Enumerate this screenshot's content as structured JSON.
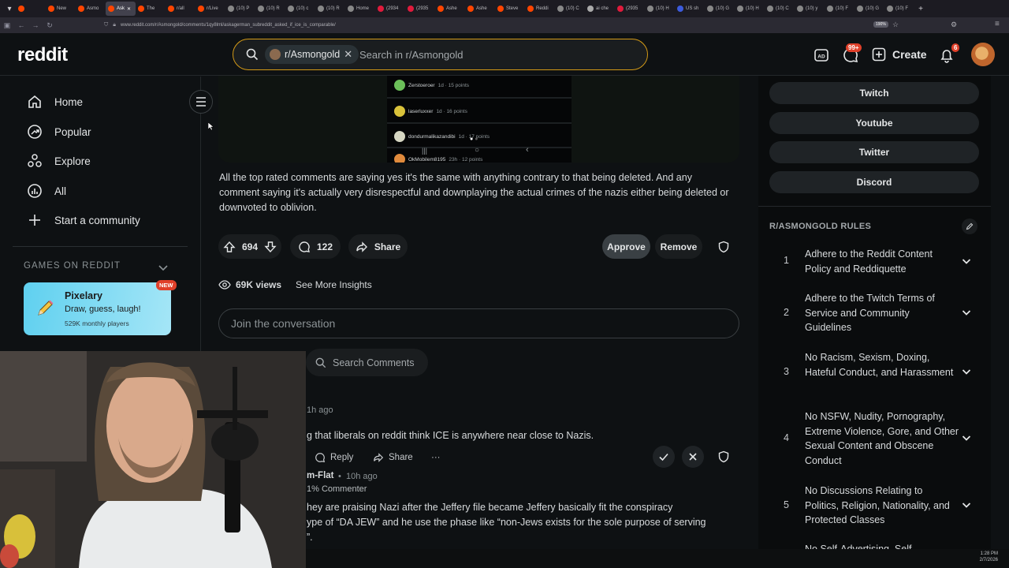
{
  "browser": {
    "tabs": [
      {
        "label": "",
        "color": "#ff4500"
      },
      {
        "label": "New",
        "color": "#ff4500"
      },
      {
        "label": "Asmo",
        "color": "#ff4500"
      },
      {
        "label": "Ask",
        "color": "#ff4500",
        "active": true
      },
      {
        "label": "The",
        "color": "#ff4500"
      },
      {
        "label": "r/all",
        "color": "#ff4500"
      },
      {
        "label": "r/Live",
        "color": "#ff4500"
      },
      {
        "label": "(10) P",
        "color": "#888888"
      },
      {
        "label": "(10) R",
        "color": "#888888"
      },
      {
        "label": "(10) c",
        "color": "#888888"
      },
      {
        "label": "(10) R",
        "color": "#888888"
      },
      {
        "label": "Home",
        "color": "#888888"
      },
      {
        "label": "(2934",
        "color": "#e01b3c"
      },
      {
        "label": "(2935",
        "color": "#e01b3c"
      },
      {
        "label": "Ashe",
        "color": "#ff4500"
      },
      {
        "label": "Ashe",
        "color": "#ff4500"
      },
      {
        "label": "Steve",
        "color": "#ff4500"
      },
      {
        "label": "Reddi",
        "color": "#ff4500"
      },
      {
        "label": "(10) C",
        "color": "#888888"
      },
      {
        "label": "ai che",
        "color": "#aaaaaa"
      },
      {
        "label": "(2935",
        "color": "#e01b3c"
      },
      {
        "label": "(10) H",
        "color": "#888888"
      },
      {
        "label": "US sh",
        "color": "#3c5bdc"
      },
      {
        "label": "(10) G",
        "color": "#888888"
      },
      {
        "label": "(10) H",
        "color": "#888888"
      },
      {
        "label": "(10) C",
        "color": "#888888"
      },
      {
        "label": "(10) y",
        "color": "#888888"
      },
      {
        "label": "(10) F",
        "color": "#888888"
      },
      {
        "label": "(10) G",
        "color": "#888888"
      },
      {
        "label": "(10) F",
        "color": "#888888"
      }
    ],
    "url": "www.reddit.com/r/Asmongold/comments/1qy8lml/askagerman_subreddit_asked_if_ice_is_comparable/",
    "zoom": "190%"
  },
  "header": {
    "logo": "reddit",
    "search_chip": "r/Asmongold",
    "search_placeholder": "Search in r/Asmongold",
    "create_label": "Create",
    "chat_badge": "99+",
    "notif_badge": "6"
  },
  "left_nav": {
    "items": [
      "Home",
      "Popular",
      "Explore",
      "All",
      "Start a community"
    ],
    "games_header": "GAMES ON REDDIT",
    "game": {
      "title": "Pixelary",
      "subtitle": "Draw, guess, laugh!",
      "players": "529K monthly players",
      "badge": "NEW"
    }
  },
  "post": {
    "image_comments": [
      {
        "user": "Zerstoeroer",
        "meta": "1d · 15 points",
        "color": "#6bbf59"
      },
      {
        "user": "laserluxxer",
        "meta": "1d · 16 points",
        "color": "#d9c23a"
      },
      {
        "user": "dondurmalikazandibi",
        "meta": "1d · 17 points",
        "color": "#d6d6c2"
      },
      {
        "user": "OkMobilem8195",
        "meta": "23h · 12 points",
        "color": "#e08a3c"
      }
    ],
    "body": "All the top rated comments are saying yes it's the same with anything contrary to that being deleted. And any comment saying it's actually very disrespectful and downplaying the actual crimes of the nazis either being deleted or downvoted to oblivion.",
    "votes": "694",
    "comments": "122",
    "share_label": "Share",
    "approve_label": "Approve",
    "remove_label": "Remove",
    "views": "69K views",
    "insights_label": "See More Insights",
    "join_placeholder": "Join the conversation",
    "search_comments_label": "Search Comments"
  },
  "comments": [
    {
      "meta": "1h ago",
      "text": "g that liberals on reddit think ICE is anywhere near close to Nazis.",
      "reply_label": "Reply",
      "share_label": "Share",
      "more_label": "···"
    },
    {
      "user": "m-Flat",
      "meta": "10h ago",
      "flair": "1% Commenter",
      "line1": "hey are praising Nazi after the Jeffery file became Jeffery basically fit the conspiracy",
      "line2": "ype of “DA JEW” and he use the phase like “non-Jews exists for the sole purpose of serving",
      "line3": "”."
    }
  ],
  "right_sidebar": {
    "links": [
      "Twitch",
      "Youtube",
      "Twitter",
      "Discord"
    ],
    "rules_title": "R/ASMONGOLD RULES",
    "rules": [
      {
        "num": "1",
        "text": "Adhere to the Reddit Content Policy and Reddiquette"
      },
      {
        "num": "2",
        "text": "Adhere to the Twitch Terms of Service and Community Guidelines"
      },
      {
        "num": "3",
        "text": "No Racism, Sexism, Doxing, Hateful Conduct, and Harassment"
      },
      {
        "num": "4",
        "text": "No NSFW, Nudity, Pornography, Extreme Violence, Gore, and Other Sexual Content and Obscene Conduct"
      },
      {
        "num": "5",
        "text": "No Discussions Relating to Politics, Religion, Nationality, and Protected Classes"
      },
      {
        "num": "6",
        "text": "No Self-Advertising, Self-"
      }
    ]
  },
  "taskbar": {
    "time": "1:28 PM",
    "date": "2/7/2026"
  }
}
